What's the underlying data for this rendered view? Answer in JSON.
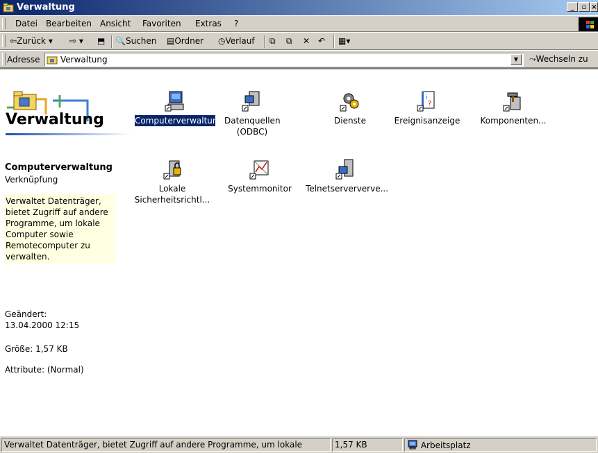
{
  "window": {
    "title": "Verwaltung"
  },
  "menu": [
    "Datei",
    "Bearbeiten",
    "Ansicht",
    "Favoriten",
    "Extras",
    "?"
  ],
  "toolbar": {
    "back": "Zurück",
    "search": "Suchen",
    "folders": "Ordner",
    "history": "Verlauf"
  },
  "address": {
    "label": "Adresse",
    "value": "Verwaltung",
    "go": "Wechseln zu"
  },
  "sidebar": {
    "title": "Verwaltung",
    "selected_name": "Computerverwaltung",
    "selected_type": "Verknüpfung",
    "description": "Verwaltet Datenträger, bietet Zugriff auf andere Programme, um lokale Computer sowie Remotecomputer zu verwalten.",
    "changed_label": "Geändert:",
    "changed_value": "13.04.2000 12:15",
    "size": "Größe: 1,57 KB",
    "attributes": "Attribute: (Normal)"
  },
  "icons": [
    {
      "label": "Computerverwaltung",
      "icon": "computer-management-icon"
    },
    {
      "label": "Datenquellen (ODBC)",
      "icon": "data-sources-icon"
    },
    {
      "label": "Dienste",
      "icon": "services-gears-icon"
    },
    {
      "label": "Ereignisanzeige",
      "icon": "event-viewer-icon"
    },
    {
      "label": "Komponenten...",
      "icon": "component-services-icon"
    },
    {
      "label": "Lokale Sicherheitsrichtl...",
      "icon": "local-security-policy-icon"
    },
    {
      "label": "Systemmonitor",
      "icon": "system-monitor-icon"
    },
    {
      "label": "Telnetserververve...",
      "icon": "telnet-server-icon"
    }
  ],
  "status": {
    "text": "Verwaltet Datenträger, bietet Zugriff auf andere Programme, um lokale",
    "size": "1,57 KB",
    "zone": "Arbeitsplatz"
  },
  "colors": {
    "titlebar_start": "#0a246a",
    "titlebar_end": "#a6caf0",
    "selection": "#0a246a",
    "infotip": "#ffffe1",
    "face": "#d4d0c8"
  }
}
